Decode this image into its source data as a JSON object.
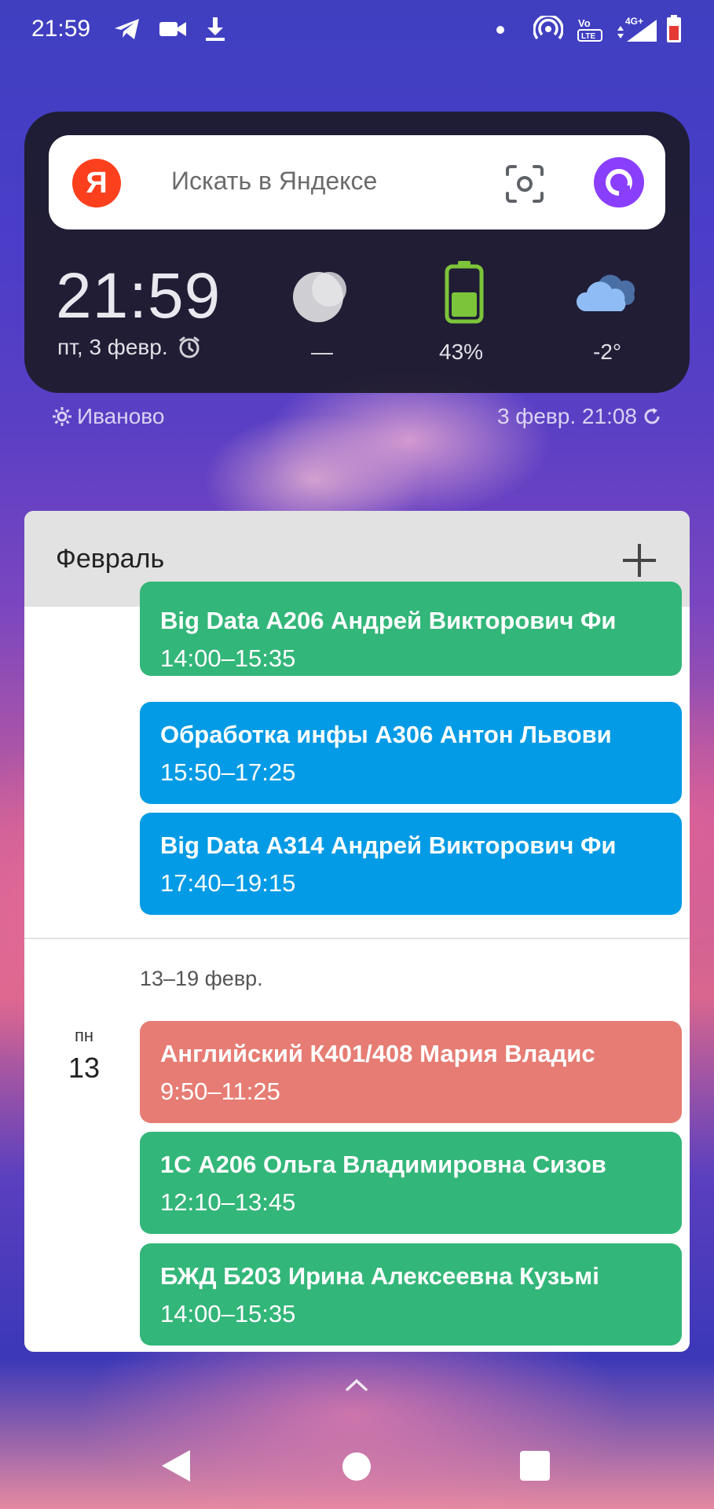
{
  "status_bar": {
    "time": "21:59",
    "icons": [
      "telegram-icon",
      "video-camera-icon",
      "download-icon",
      "notification-dot-icon",
      "hotspot-icon",
      "volte-icon",
      "signal-4g-icon",
      "battery-low-icon"
    ],
    "network": "4G+",
    "volte": "VoLTE"
  },
  "search_widget": {
    "logo": "Я",
    "placeholder": "Искать в Яндексе",
    "time": "21:59",
    "date": "пт, 3 февр.",
    "moon_value": "—",
    "battery": "43%",
    "battery_level": 0.43,
    "temperature": "-2°",
    "city": "Иваново",
    "updated": "3 февр. 21:08",
    "colors": {
      "yandex_red": "#fc3f1d",
      "alice_purple": "#8a3ffc",
      "battery_green": "#7cc43a",
      "cloud_blue": "#8fbcf5"
    }
  },
  "calendar": {
    "month": "Февраль",
    "add_label": "+",
    "events_top": [
      {
        "title": "Big Data А206 Андрей Викторович Фи",
        "time": "14:00–15:35",
        "color": "green"
      },
      {
        "title": "Обработка инфы А306 Антон Львови",
        "time": "15:50–17:25",
        "color": "blue"
      },
      {
        "title": "Big Data А314 Андрей Викторович Фи",
        "time": "17:40–19:15",
        "color": "blue"
      }
    ],
    "week_label": "13–19 февр.",
    "day_name": "пн",
    "day_number": "13",
    "events_day": [
      {
        "title": "Английский К401/408 Мария Владис",
        "time": "9:50–11:25",
        "color": "red"
      },
      {
        "title": "1С А206 Ольга Владимировна Сизов",
        "time": "12:10–13:45",
        "color": "green"
      },
      {
        "title": "БЖД Б203 Ирина Алексеевна Кузьмі",
        "time": "14:00–15:35",
        "color": "green"
      }
    ]
  },
  "navigation": {
    "buttons": [
      "back-icon",
      "home-icon",
      "recents-icon"
    ]
  }
}
